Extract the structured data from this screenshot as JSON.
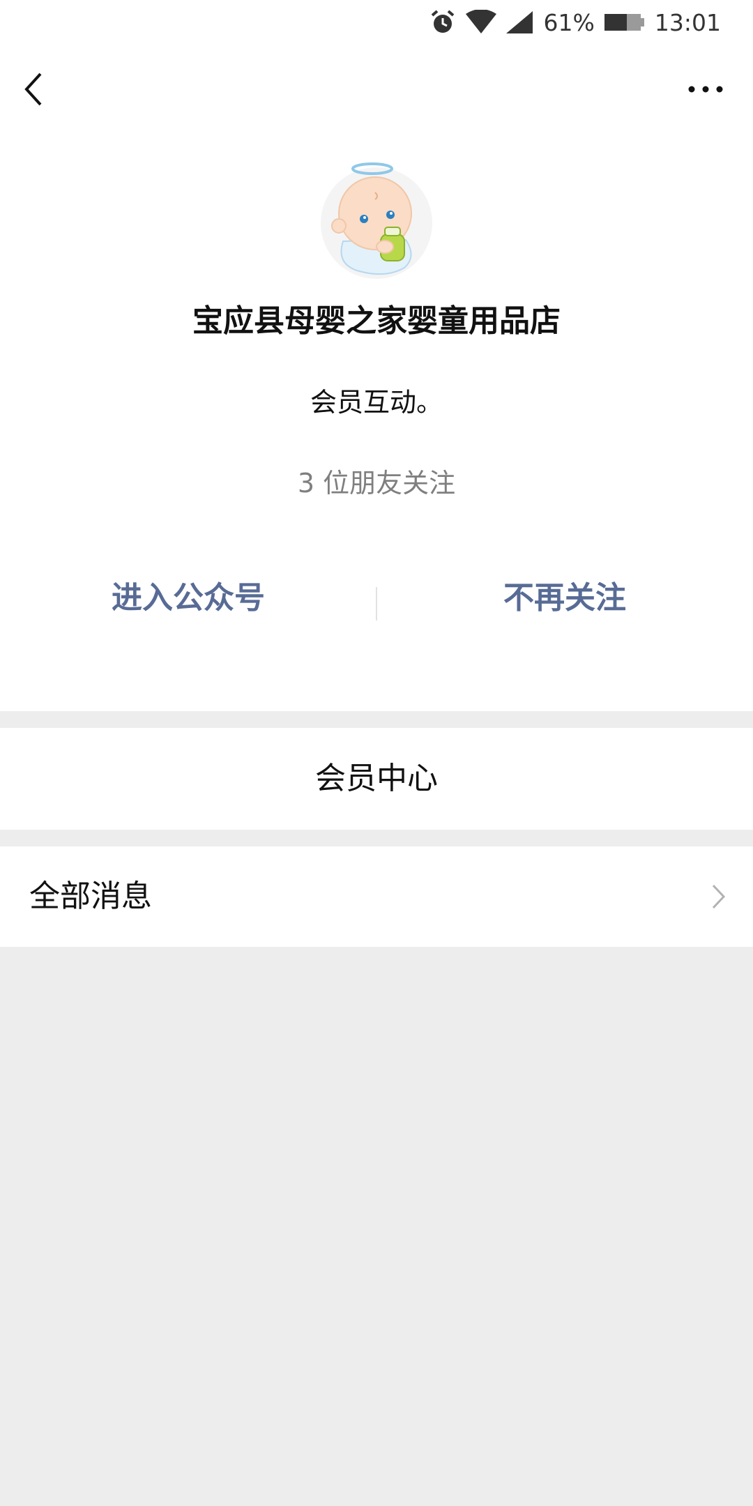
{
  "status_bar": {
    "battery_percent": "61%",
    "time": "13:01",
    "icons": [
      "alarm-icon",
      "wifi-icon",
      "signal-icon",
      "battery-icon"
    ]
  },
  "nav": {
    "back_icon": "back-arrow-icon",
    "more_icon": "more-dots-icon"
  },
  "profile": {
    "avatar_icon": "baby-avatar-icon",
    "name": "宝应县母婴之家婴童用品店",
    "description": "会员互动。",
    "followers": "3 位朋友关注",
    "enter_label": "进入公众号",
    "unfollow_label": "不再关注"
  },
  "menu": {
    "member_center": "会员中心",
    "all_messages": "全部消息"
  },
  "colors": {
    "link_blue": "#576b95",
    "page_background": "#ededed",
    "muted_text": "#7f7f7f"
  }
}
